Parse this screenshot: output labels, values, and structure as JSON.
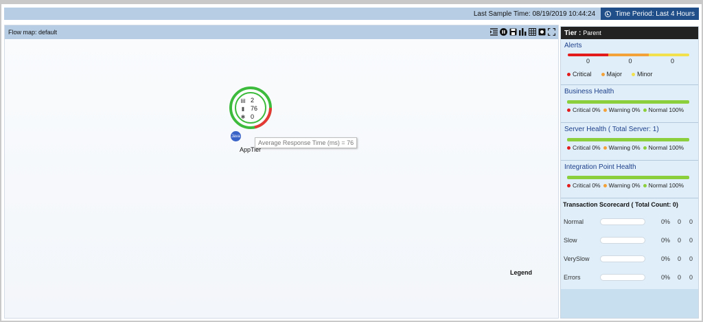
{
  "topbar": {
    "sample_time": "Last Sample Time: 08/19/2019 10:44:24",
    "time_period": "Time Period: Last 4 Hours"
  },
  "flowmap": {
    "title": "Flow map: default",
    "tools": [
      "list-indent-icon",
      "pause-icon",
      "save-icon",
      "bar-chart-icon",
      "grid-icon",
      "screenshot-icon",
      "fullscreen-icon"
    ],
    "node": {
      "name": "AppTier",
      "badge": "Java",
      "stats": [
        {
          "icon": "calls-icon",
          "value": "2"
        },
        {
          "icon": "bar-icon",
          "value": "76"
        },
        {
          "icon": "error-icon",
          "value": "0"
        }
      ],
      "ring_colors": {
        "health": "#3dbb3d",
        "alert": "#e53935"
      }
    },
    "tooltip": "Average Response Time (ms) = 76",
    "legend": "Legend"
  },
  "tier_panel": {
    "header_label": "Tier :",
    "header_value": "Parent",
    "alerts": {
      "title": "Alerts",
      "counts": [
        "0",
        "0",
        "0"
      ],
      "labels": [
        "Critical",
        "Major",
        "Minor"
      ],
      "colors": [
        "#e31b1b",
        "#f3a23a",
        "#f2e14c"
      ]
    },
    "business_health": {
      "title": "Business Health",
      "critical": "Critical 0%",
      "warning": "Warning 0%",
      "normal": "Normal 100%"
    },
    "server_health": {
      "title": "Server Health ( Total Server: 1)",
      "critical": "Critical 0%",
      "warning": "Warning 0%",
      "normal": "Normal 100%"
    },
    "integration_health": {
      "title": "Integration Point Health",
      "critical": "Critical 0%",
      "warning": "Warning 0%",
      "normal": "Normal 100%"
    },
    "scorecard": {
      "title": "Transaction Scorecard  ( Total Count: 0)",
      "rows": [
        {
          "label": "Normal",
          "pct": "0%",
          "c1": "0",
          "c2": "0"
        },
        {
          "label": "Slow",
          "pct": "0%",
          "c1": "0",
          "c2": "0"
        },
        {
          "label": "VerySlow",
          "pct": "0%",
          "c1": "0",
          "c2": "0"
        },
        {
          "label": "Errors",
          "pct": "0%",
          "c1": "0",
          "c2": "0"
        }
      ]
    }
  }
}
